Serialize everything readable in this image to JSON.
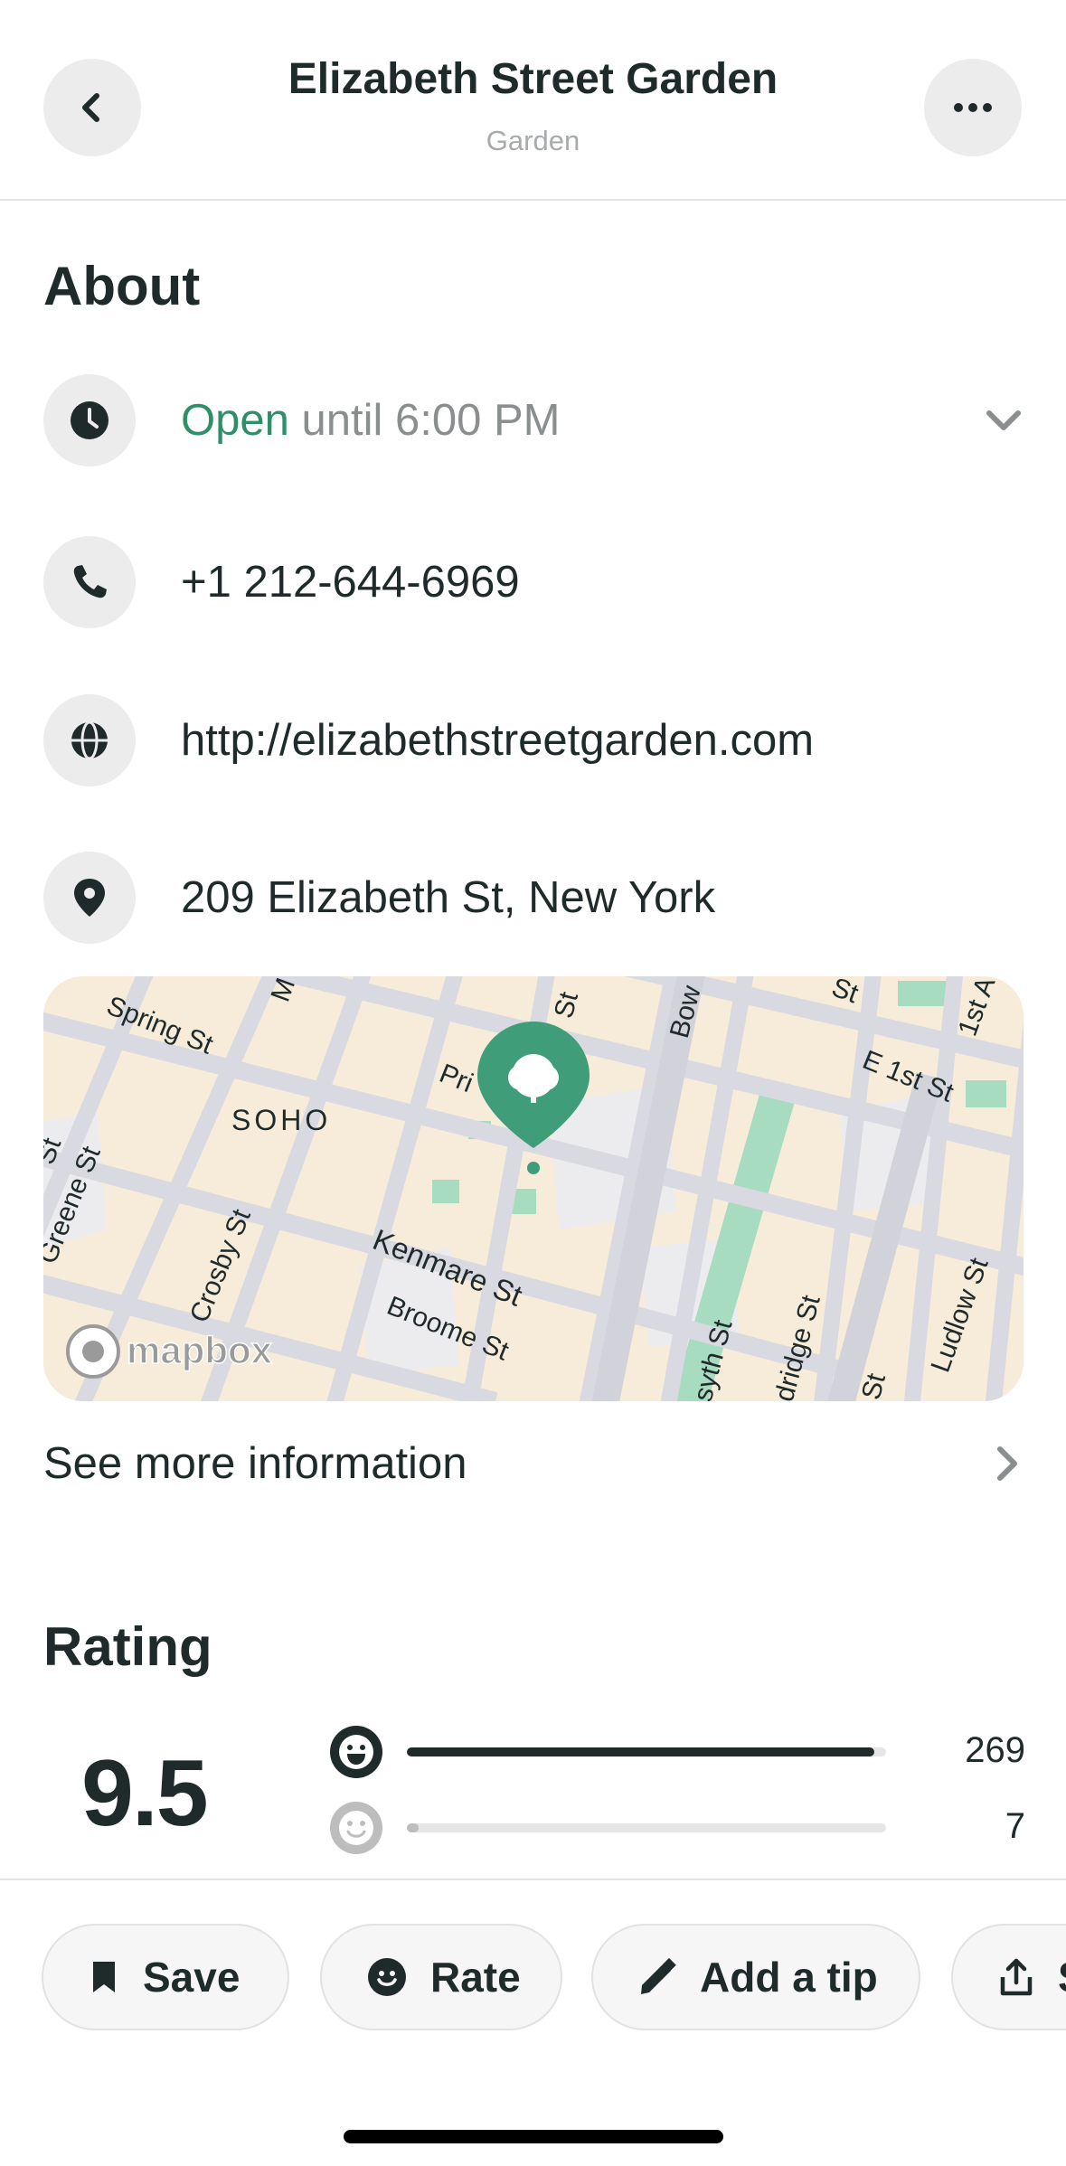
{
  "header": {
    "title": "Elizabeth Street Garden",
    "subtitle": "Garden",
    "back_icon": "chevron-left-icon",
    "more_icon": "more-dots-icon"
  },
  "about": {
    "heading": "About",
    "hours": {
      "icon": "clock-icon",
      "status": "Open",
      "detail": "until 6:00 PM",
      "expand_icon": "chevron-down-icon"
    },
    "phone": {
      "icon": "phone-icon",
      "value": "+1 212-644-6969"
    },
    "website": {
      "icon": "globe-icon",
      "value": "http://elizabethstreetgarden.com"
    },
    "address": {
      "icon": "location-pin-icon",
      "value": "209 Elizabeth St, New York"
    },
    "map": {
      "attribution": "mapbox",
      "labels": {
        "spring": "Spring St",
        "soho": "SOHO",
        "greene": "Greene St",
        "crosby": "Crosby St",
        "kenmare": "Kenmare St",
        "broome": "Broome St",
        "prince": "Pri",
        "st_top": "St",
        "bow": "Bow",
        "st_top2": "St",
        "first_ave": "1st A",
        "e1st": "E 1st St",
        "forsyth": "syth St",
        "eldridge": "dridge St",
        "ludlow": "Ludlow St",
        "st_bottom": "St",
        "st_left": "St",
        "m_label": "M"
      },
      "colors": {
        "base": "#f6ecd9",
        "street": "#d9d9e1",
        "park": "#a8dcc0",
        "pin": "#3f9d79"
      }
    },
    "see_more": "See more information"
  },
  "rating": {
    "heading": "Rating",
    "score": "9.5",
    "rows": [
      {
        "face": "grinning-face-icon",
        "count": "269",
        "fraction": 0.975,
        "active": true
      },
      {
        "face": "smiling-face-icon",
        "count": "7",
        "fraction": 0.025,
        "active": false
      }
    ]
  },
  "actions": [
    {
      "icon": "bookmark-icon",
      "label": "Save"
    },
    {
      "icon": "smile-icon",
      "label": "Rate"
    },
    {
      "icon": "pencil-icon",
      "label": "Add a tip"
    },
    {
      "icon": "share-icon",
      "label": "Share"
    }
  ]
}
